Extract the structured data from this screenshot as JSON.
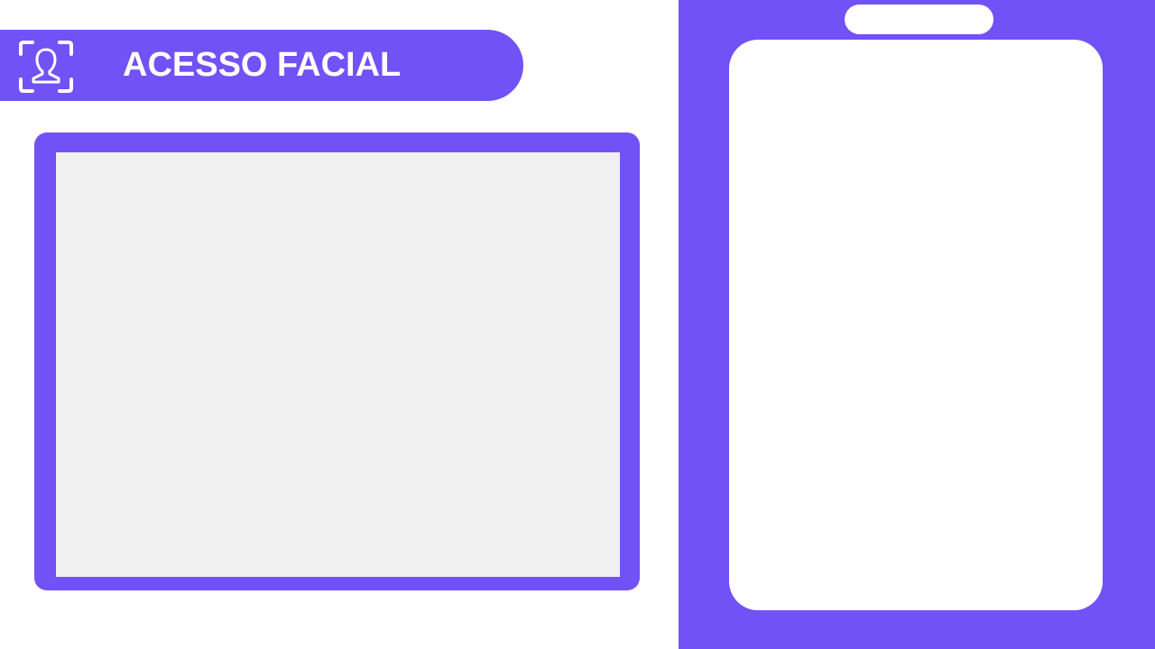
{
  "header": {
    "icon": "face-scan-icon",
    "title": "ACESSO FACIAL"
  },
  "camera": {
    "content": ""
  },
  "side_panel": {
    "card_content": ""
  },
  "colors": {
    "accent": "#7152f6",
    "camera_background": "#f0f0f0",
    "card_background": "#ffffff"
  }
}
